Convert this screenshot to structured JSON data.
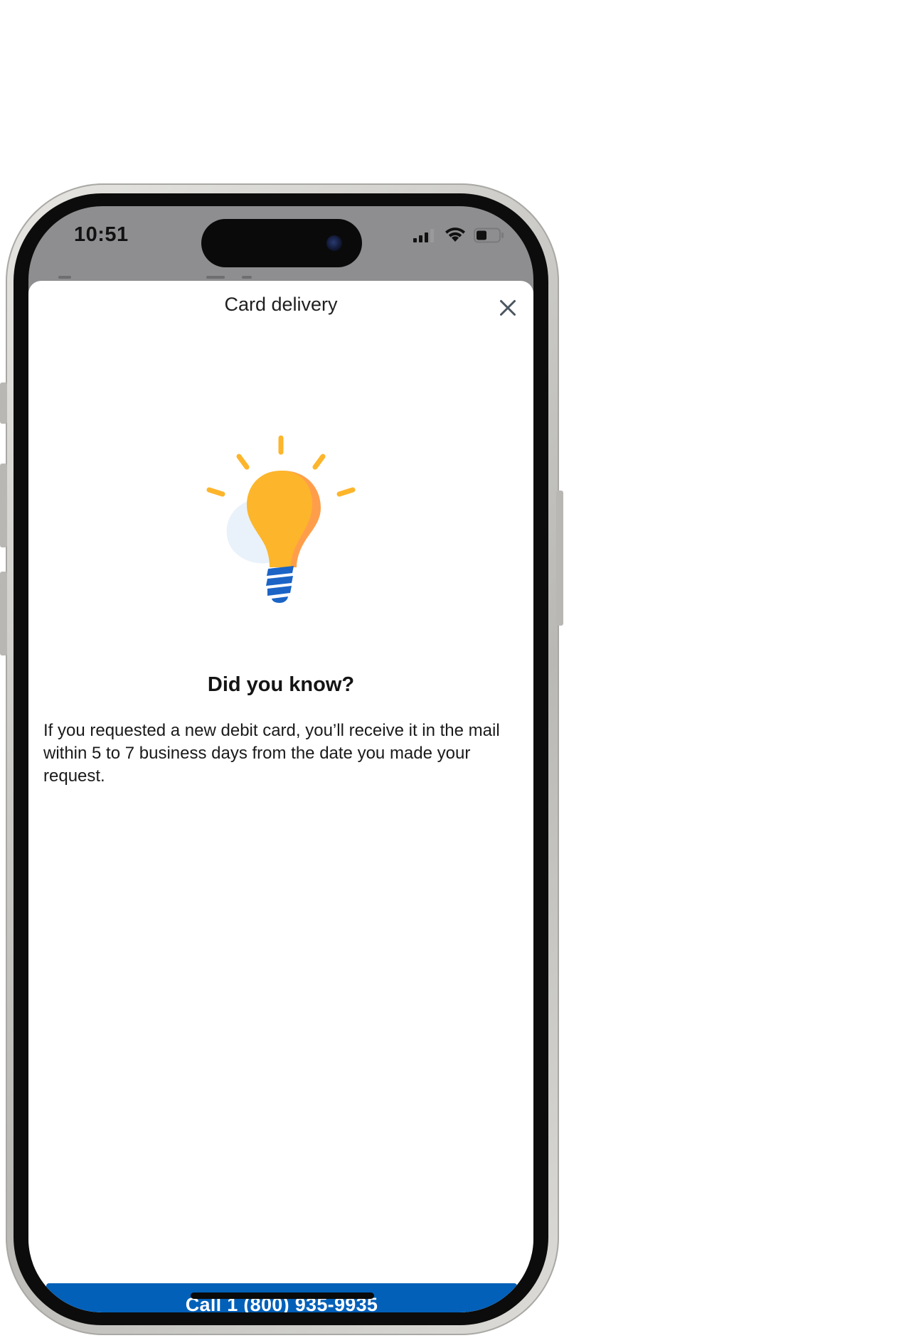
{
  "status_bar": {
    "time": "10:51",
    "icons": [
      "cellular-signal-icon",
      "wifi-icon",
      "battery-icon"
    ]
  },
  "sheet": {
    "title": "Card delivery",
    "close_icon": "close-icon"
  },
  "illustration": {
    "icon": "lightbulb-icon",
    "colors": {
      "bulb": "#FDB52B",
      "bulb_shade": "#FF9E4A",
      "rays": "#FDB52B",
      "base": "#1B64C6",
      "glow": "#E9F2FA"
    }
  },
  "content": {
    "heading": "Did you know?",
    "body": "If you requested a new debit card, you’ll receive it in the mail within 5 to 7 business days from the date you made your request."
  },
  "cta": {
    "label": "Call 1 (800) 935-9935"
  },
  "colors": {
    "primary": "#0260B9",
    "text": "#1A1A1A",
    "sheet_background": "#FFFFFF",
    "backdrop": "#8E8E90"
  }
}
